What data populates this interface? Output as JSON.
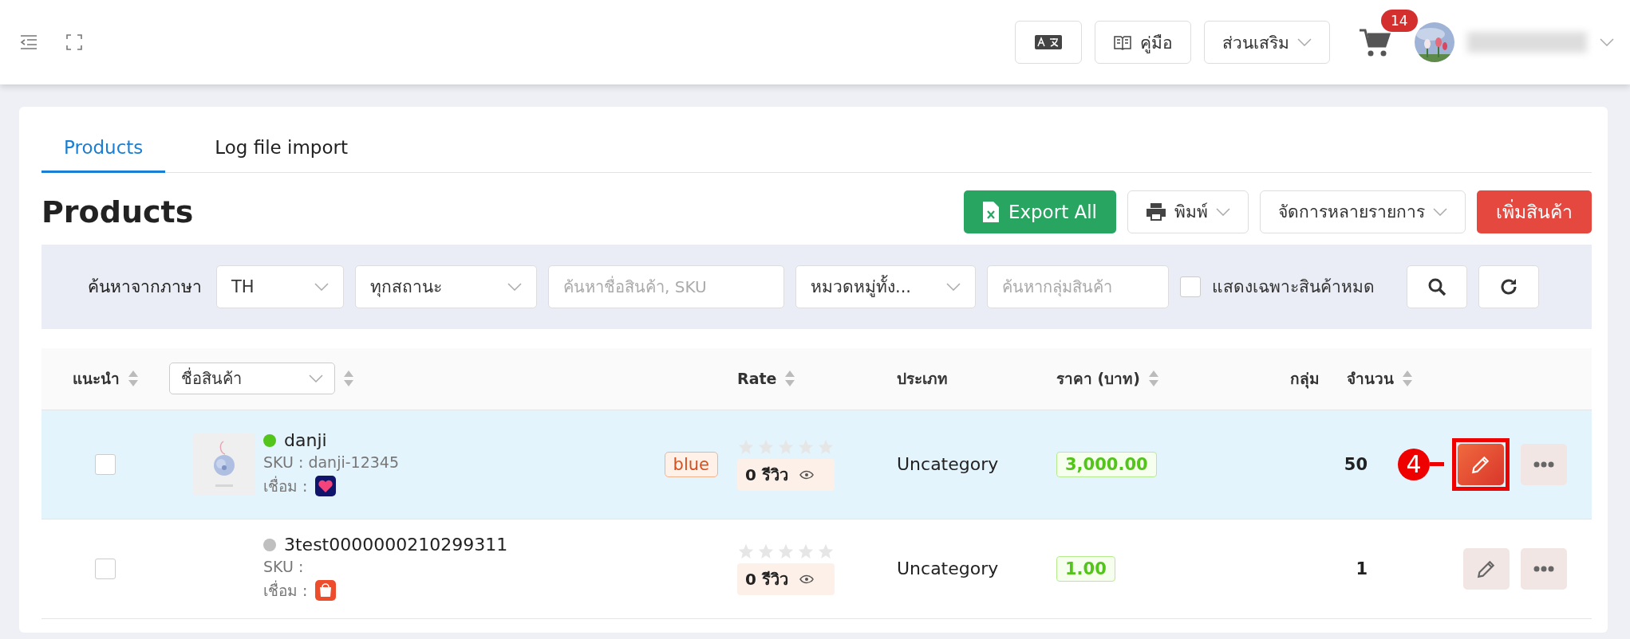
{
  "topbar": {
    "manual": "คู่มือ",
    "addons": "ส่วนเสริม",
    "cart_count": "14"
  },
  "tabs": [
    {
      "label": "Products",
      "selected": true
    },
    {
      "label": "Log file import",
      "selected": false
    }
  ],
  "page_title": "Products",
  "actions": {
    "export": "Export All",
    "print": "พิมพ์",
    "bulk": "จัดการหลายรายการ",
    "add": "เพิ่มสินค้า"
  },
  "filters": {
    "label": "ค้นหาจากภาษา",
    "language": "TH",
    "status": "ทุกสถานะ",
    "search_placeholder": "ค้นหาชื่อสินค้า, SKU",
    "category": "หมวดหมู่ทั้ง...",
    "group_placeholder": "ค้นหากลุ่มสินค้า",
    "out_of_stock_only": {
      "label": "แสดงเฉพาะสินค้าหมด",
      "checked": false
    }
  },
  "table": {
    "columns": {
      "recommend": "แนะนำ",
      "name_select": "ชื่อสินค้า",
      "rate": "Rate",
      "type": "ประเภท",
      "price": "ราคา (บาท)",
      "group": "กลุ่ม",
      "qty": "จำนวน"
    },
    "rows": [
      {
        "selected": true,
        "checked": false,
        "has_image": true,
        "color": "#52c41a",
        "name": "danji",
        "sku": "SKU : danji-12345",
        "link_label": "เชื่อม :",
        "channel": {
          "kind": "lazada"
        },
        "tag": "blue",
        "stars": 0,
        "reviews": "0 รีวิว",
        "type": "Uncategory",
        "price": "3,000.00",
        "qty": "50",
        "callout": "4"
      },
      {
        "selected": false,
        "checked": false,
        "has_image": false,
        "color": "#bfbfbf",
        "name": "3test0000000210299311",
        "sku": "SKU :",
        "link_label": "เชื่อม :",
        "channel": {
          "kind": "shopee"
        },
        "stars": 0,
        "reviews": "0 รีวิว",
        "type": "Uncategory",
        "price": "1.00",
        "qty": "1"
      }
    ]
  }
}
